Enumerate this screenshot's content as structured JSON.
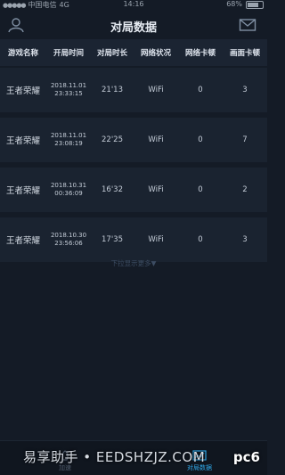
{
  "status_bar": {
    "carrier": "中国电信",
    "network": "4G",
    "time": "14:16",
    "battery": "68%"
  },
  "nav": {
    "title": "对局数据"
  },
  "table": {
    "headers": [
      "游戏名称",
      "开局时间",
      "对局时长",
      "网络状况",
      "网络卡顿",
      "画面卡顿"
    ],
    "rows": [
      {
        "game": "王者荣耀",
        "date": "2018.11.01",
        "clock": "23:33:15",
        "duration": "21'13",
        "network": "WiFi",
        "net_lag": "0",
        "frame_lag": "3"
      },
      {
        "game": "王者荣耀",
        "date": "2018.11.01",
        "clock": "23:08:19",
        "duration": "22'25",
        "network": "WiFi",
        "net_lag": "0",
        "frame_lag": "7"
      },
      {
        "game": "王者荣耀",
        "date": "2018.10.31",
        "clock": "00:36:09",
        "duration": "16'32",
        "network": "WiFi",
        "net_lag": "0",
        "frame_lag": "2"
      },
      {
        "game": "王者荣耀",
        "date": "2018.10.30",
        "clock": "23:56:06",
        "duration": "17'35",
        "network": "WiFi",
        "net_lag": "0",
        "frame_lag": "3"
      }
    ]
  },
  "more_hint": "下拉显示更多▼",
  "tabs": {
    "accelerate": "加速",
    "stats": "对局数据"
  },
  "watermark": {
    "text": "易享助手 • EEDSHZJZ.COM",
    "logo": "pc6"
  },
  "colors": {
    "background": "#141b26",
    "row": "#1a2330",
    "accent": "#2fa8e8"
  }
}
